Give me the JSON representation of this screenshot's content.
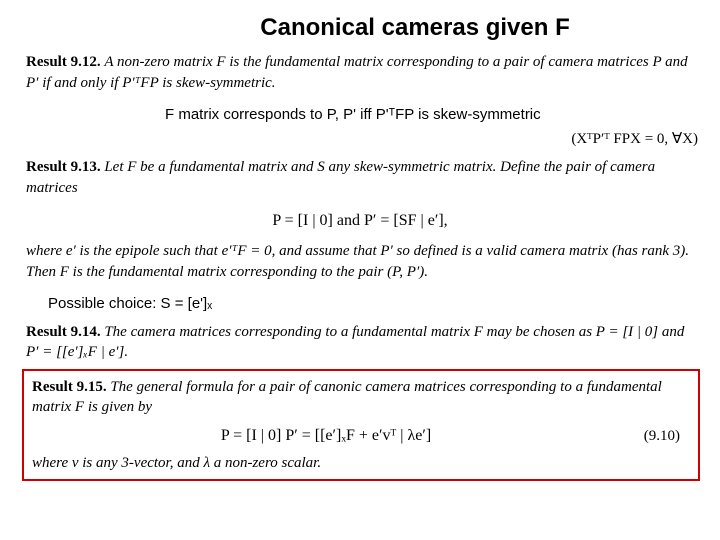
{
  "title": "Canonical cameras given F",
  "r912": {
    "label": "Result 9.12.",
    "body": " A non-zero matrix F is the fundamental matrix corresponding to a pair of camera matrices P and P′ if and only if P′ᵀFP is skew-symmetric."
  },
  "note1": "F matrix corresponds to P, P' iff P'ᵀFP is skew-symmetric",
  "side_eq": "(XᵀP′ᵀ FPX = 0, ∀X)",
  "r913": {
    "label": "Result 9.13.",
    "lead": " Let F be a fundamental matrix and S any skew-symmetric matrix. Define the pair of camera matrices",
    "eq": "P = [I | 0]   and   P′ = [SF | e′],",
    "tail": "where e′ is the epipole such that e′ᵀF = 0, and assume that P′ so defined is a valid camera matrix (has rank 3). Then F is the fundamental matrix corresponding to the pair (P, P′)."
  },
  "choice": "Possible choice: S = [e']ₓ",
  "r914": {
    "label": "Result 9.14.",
    "body": " The camera matrices corresponding to a fundamental matrix F may be chosen as P = [I | 0] and P′ = [[e′]ₓF | e′]."
  },
  "r915": {
    "label": "Result 9.15.",
    "lead": " The general formula for a pair of canonic camera matrices corresponding to a fundamental matrix F is given by",
    "eq": "P = [I | 0]    P′ = [[e′]ₓF + e′vᵀ | λe′]",
    "eqnum": "(9.10)",
    "tail": "where v is any 3-vector, and λ a non-zero scalar."
  }
}
